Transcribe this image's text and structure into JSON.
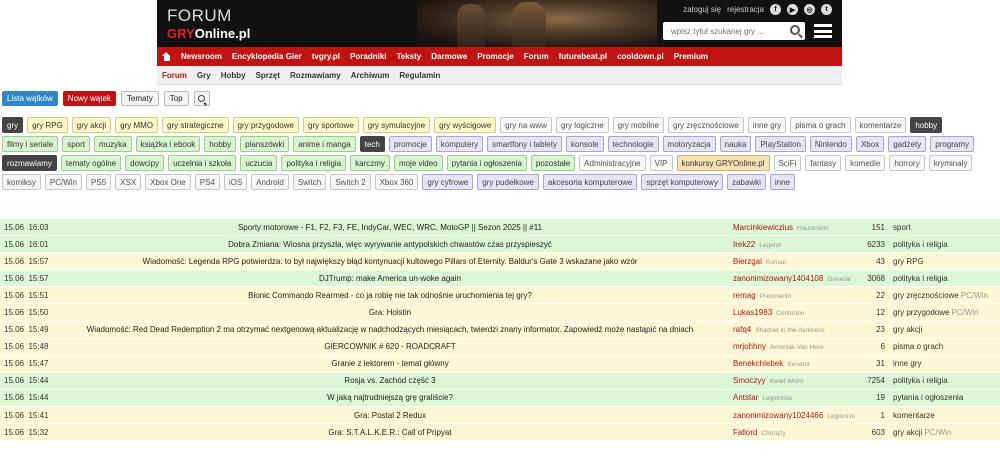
{
  "header": {
    "logo_top": "FORUM",
    "logo_gry": "GRY",
    "logo_online": "Online.pl",
    "login": "zaloguj się",
    "register": "rejestracja",
    "social": [
      "f",
      "▶",
      "◎",
      "t"
    ],
    "search_placeholder": "wpisz tytuł szukanej gry ..."
  },
  "rednav": [
    "Newsroom",
    "Encyklopedia Gier",
    "tvgry.pl",
    "Poradniki",
    "Teksty",
    "Darmowe",
    "Promocje",
    "Forum",
    "futurebeat.pl",
    "cooldown.pl",
    "Premium"
  ],
  "subnav": [
    {
      "label": "Forum",
      "active": true
    },
    {
      "label": "Gry"
    },
    {
      "label": "Hobby"
    },
    {
      "label": "Sprzęt"
    },
    {
      "label": "Rozmawiamy"
    },
    {
      "label": "Archiwum"
    },
    {
      "label": "Regulamin"
    }
  ],
  "actions": {
    "list": "Lista wątków",
    "new": "Nowy wątek",
    "topics": "Tematy",
    "top": "Top"
  },
  "tags": [
    {
      "label": "gry",
      "style": "dark"
    },
    {
      "label": "gry RPG",
      "style": "yellow"
    },
    {
      "label": "gry akcji",
      "style": "yellow"
    },
    {
      "label": "gry MMO",
      "style": "yellow"
    },
    {
      "label": "gry strategiczne",
      "style": "yellow"
    },
    {
      "label": "gry przygodowe",
      "style": "yellow"
    },
    {
      "label": "gry sportowe",
      "style": "yellow"
    },
    {
      "label": "gry symulacyjne",
      "style": "yellow"
    },
    {
      "label": "gry wyścigowe",
      "style": "yellow"
    },
    {
      "label": "gry na www",
      "style": "grey"
    },
    {
      "label": "gry logiczne",
      "style": "grey"
    },
    {
      "label": "gry mobilne",
      "style": "grey"
    },
    {
      "label": "gry zręcznościowe",
      "style": "grey"
    },
    {
      "label": "inne gry",
      "style": "grey"
    },
    {
      "label": "pisma o grach",
      "style": "grey"
    },
    {
      "label": "komentarze",
      "style": "grey"
    },
    {
      "label": "hobby",
      "style": "dark"
    },
    {
      "label": "filmy i seriale",
      "style": "green"
    },
    {
      "label": "sport",
      "style": "green"
    },
    {
      "label": "muzyka",
      "style": "green"
    },
    {
      "label": "książka i ebook",
      "style": "green"
    },
    {
      "label": "hobby",
      "style": "green"
    },
    {
      "label": "planszówki",
      "style": "green"
    },
    {
      "label": "anime i manga",
      "style": "green"
    },
    {
      "label": "tech",
      "style": "dark"
    },
    {
      "label": "promocje",
      "style": "lavender"
    },
    {
      "label": "komputery",
      "style": "lavender"
    },
    {
      "label": "smartfony i tablety",
      "style": "lavender"
    },
    {
      "label": "konsole",
      "style": "lavender"
    },
    {
      "label": "technologie",
      "style": "lavender"
    },
    {
      "label": "motoryzacja",
      "style": "lavender"
    },
    {
      "label": "nauka",
      "style": "lavender"
    },
    {
      "label": "PlayStation",
      "style": "lavender"
    },
    {
      "label": "Nintendo",
      "style": "lavender"
    },
    {
      "label": "Xbox",
      "style": "lavender"
    },
    {
      "label": "gadżety",
      "style": "lavender"
    },
    {
      "label": "programy",
      "style": "lavender"
    },
    {
      "label": "rozmawiamy",
      "style": "dark"
    },
    {
      "label": "tematy ogólne",
      "style": "green"
    },
    {
      "label": "dowcipy",
      "style": "green"
    },
    {
      "label": "uczelnia i szkoła",
      "style": "green"
    },
    {
      "label": "uczucia",
      "style": "green"
    },
    {
      "label": "polityka i religia",
      "style": "green"
    },
    {
      "label": "karczmy",
      "style": "green"
    },
    {
      "label": "moje video",
      "style": "green"
    },
    {
      "label": "pytania i ogłoszenia",
      "style": "green"
    },
    {
      "label": "pozostałe",
      "style": "green"
    },
    {
      "label": "Administracyjne",
      "style": "grey"
    },
    {
      "label": "VIP",
      "style": "grey"
    },
    {
      "label": "konkursy GRYOnline.pl",
      "style": "orange"
    },
    {
      "label": "SciFi",
      "style": "grey"
    },
    {
      "label": "fantasy",
      "style": "grey"
    },
    {
      "label": "komedie",
      "style": "grey"
    },
    {
      "label": "horrory",
      "style": "grey"
    },
    {
      "label": "kryminały",
      "style": "grey"
    },
    {
      "label": "komiksy",
      "style": "grey"
    },
    {
      "label": "PC/Win",
      "style": "grey"
    },
    {
      "label": "PS5",
      "style": "grey"
    },
    {
      "label": "XSX",
      "style": "grey"
    },
    {
      "label": "Xbox One",
      "style": "grey"
    },
    {
      "label": "PS4",
      "style": "grey"
    },
    {
      "label": "iOS",
      "style": "grey"
    },
    {
      "label": "Android",
      "style": "grey"
    },
    {
      "label": "Switch",
      "style": "grey"
    },
    {
      "label": "Switch 2",
      "style": "grey"
    },
    {
      "label": "Xbox 360",
      "style": "grey"
    },
    {
      "label": "gry cyfrowe",
      "style": "lavender"
    },
    {
      "label": "gry pudełkowe",
      "style": "lavender"
    },
    {
      "label": "akcesoria komputerowe",
      "style": "lavender"
    },
    {
      "label": "sprzęt komputerowy",
      "style": "lavender"
    },
    {
      "label": "zabawki",
      "style": "lavender"
    },
    {
      "label": "inne",
      "style": "lavender"
    }
  ],
  "topics": [
    {
      "date": "15.06",
      "time": "16:03",
      "title": "Sporty motorowe - F1, F2, F3, FE, IndyCar, WEC, WRC, MotoGP || Sezon 2025 || #11",
      "user": "Marcinkiewiczius",
      "rank": "Hautameki",
      "count": "151",
      "cat": "sport",
      "sub": "",
      "color": "green"
    },
    {
      "date": "15.06",
      "time": "16:01",
      "title": "Dobra Zmiana: Wiosna przyszła, więc wyrywanie antypolskich chwastów czas przyspieszyć",
      "user": "Irek22",
      "rank": "Legend",
      "count": "6233",
      "cat": "polityka i religia",
      "sub": "",
      "color": "green"
    },
    {
      "date": "15.06",
      "time": "15:57",
      "title": "Wiadomość: Legenda RPG potwierdza: to był największy błąd kontynuacji kultowego Pillars of Eternity. Baldur's Gate 3 wskazane jako wzór",
      "user": "Bierzgal",
      "rank": "Konsul",
      "count": "43",
      "cat": "gry RPG",
      "sub": "",
      "color": "yellow"
    },
    {
      "date": "15.06",
      "time": "15:57",
      "title": "DJTrump: make America un-woke again",
      "user": "zanonimizowany1404108",
      "rank": "General",
      "count": "3068",
      "cat": "polityka i religia",
      "sub": "",
      "color": "green"
    },
    {
      "date": "15.06",
      "time": "15:51",
      "title": "Bionic Commando Rearmed - co ja robię nie tak odnośnie uruchomienia tej gry?",
      "user": "remag",
      "rank": "Pretorianin",
      "count": "22",
      "cat": "gry zręcznościowe",
      "sub": "PC/Win",
      "color": "yellow"
    },
    {
      "date": "15.06",
      "time": "15:50",
      "title": "Gra: Holstin",
      "user": "Lukas1983",
      "rank": "Centurion",
      "count": "12",
      "cat": "gry przygodowe",
      "sub": "PC/Win",
      "color": "yellow"
    },
    {
      "date": "15.06",
      "time": "15:49",
      "title": "Wiadomość: Red Dead Redemption 2 ma otrzymać nextgenową aktualizację w nadchodzących miesiącach, twierdzi znany informator. Zapowiedź może nastąpić na dniach",
      "user": "rafq4",
      "rank": "Shadow in the darkness",
      "count": "23",
      "cat": "gry akcji",
      "sub": "",
      "color": "yellow"
    },
    {
      "date": "15.06",
      "time": "15:48",
      "title": "GIERCOWNIK # 620 - ROADCRAFT",
      "user": "mrjohhny",
      "rank": "Amoniak Vas Here",
      "count": "6",
      "cat": "pisma o grach",
      "sub": "",
      "color": "yellow"
    },
    {
      "date": "15.06",
      "time": "15:47",
      "title": "Granie z lektorem - temat główny",
      "user": "Benekchlebek",
      "rank": "Senator",
      "count": "31",
      "cat": "inne gry",
      "sub": "",
      "color": "yellow"
    },
    {
      "date": "15.06",
      "time": "15:44",
      "title": "Rosja vs. Zachód część 3",
      "user": "Smoczyy",
      "rank": "Kwiat Wiśni",
      "count": "7254",
      "cat": "polityka i religia",
      "sub": "",
      "color": "green"
    },
    {
      "date": "15.06",
      "time": "15:44",
      "title": "W jaką najtrudniejszą grę graliście?",
      "user": "Antstar",
      "rank": "Legionista",
      "count": "19",
      "cat": "pytania i ogłoszenia",
      "sub": "",
      "color": "green"
    },
    {
      "date": "15.06",
      "time": "15:41",
      "title": "Gra: Postal 2 Redux",
      "user": "zanonimizowany1024466",
      "rank": "Legionista",
      "count": "1",
      "cat": "komentarze",
      "sub": "",
      "color": "yellow"
    },
    {
      "date": "15.06",
      "time": "15:32",
      "title": "Gra: S.T.A.L.K.E.R.: Call of Pripyat",
      "user": "Fallord",
      "rank": "Chorąży",
      "count": "603",
      "cat": "gry akcji",
      "sub": "PC/Win",
      "color": "yellow"
    }
  ]
}
